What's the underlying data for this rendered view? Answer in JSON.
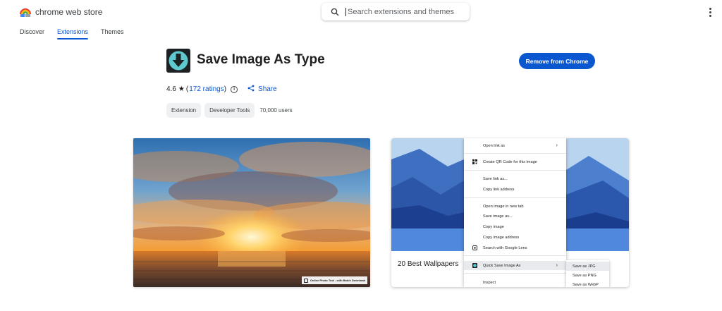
{
  "header": {
    "logo_text": "chrome web store",
    "search_placeholder": "Search extensions and themes"
  },
  "nav": {
    "tabs": [
      {
        "label": "Discover",
        "active": false
      },
      {
        "label": "Extensions",
        "active": true
      },
      {
        "label": "Themes",
        "active": false
      }
    ]
  },
  "extension": {
    "title": "Save Image As Type",
    "action_label": "Remove from Chrome",
    "rating": "4.6",
    "rating_count": "172 ratings",
    "share_label": "Share",
    "chips": [
      "Extension",
      "Developer Tools"
    ],
    "users": "70,000 users"
  },
  "screenshots": {
    "first": {
      "watermark": "Online Photo Tool - with Batch Download"
    },
    "second": {
      "caption": "20 Best Wallpapers",
      "context_menu": [
        "Open link as",
        "Create QR Code for this image",
        "Save link as...",
        "Copy link address",
        "Open image in new tab",
        "Save image as...",
        "Copy image",
        "Copy image address",
        "Search with Google Lens",
        "Quick Save Image As",
        "Inspect"
      ],
      "submenu": [
        "Save as JPG",
        "Save as PNG",
        "Save as WebP"
      ]
    }
  },
  "colors": {
    "accent": "#0b57d0",
    "icon_bg": "#1e2124",
    "icon_fg": "#5ecad0"
  }
}
